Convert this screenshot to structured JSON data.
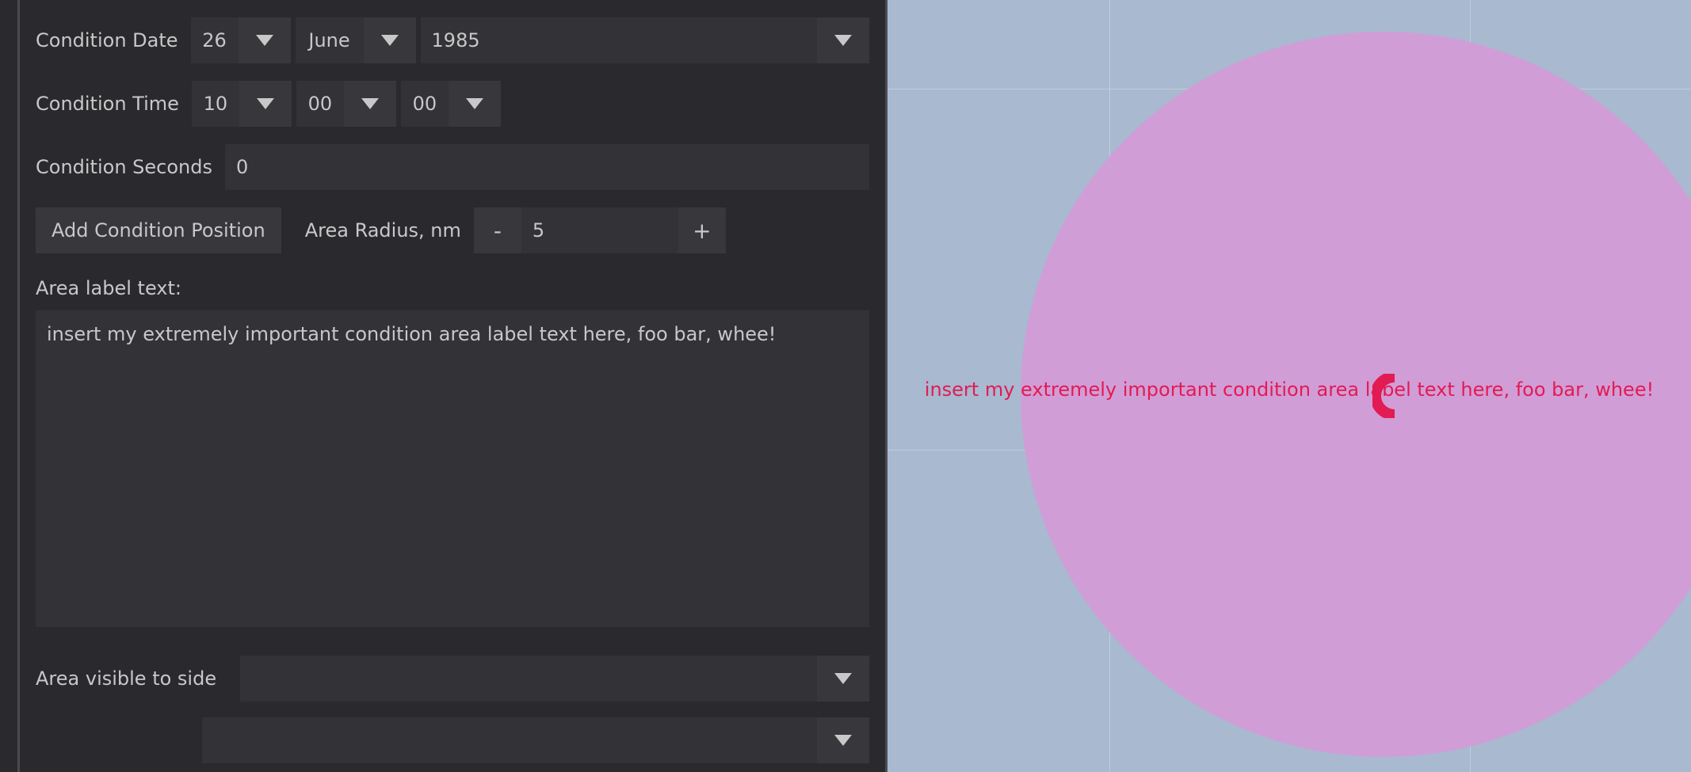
{
  "colors": {
    "panel_bg": "#2a2a2e",
    "field_bg": "#323237",
    "btn_bg": "#37373c",
    "text": "#c8c8c8",
    "map_bg": "#a8b9d0",
    "circle_fill": "#d19dd7",
    "accent": "#e21b52"
  },
  "panel": {
    "date": {
      "label": "Condition Date",
      "day": "26",
      "month": "June",
      "year": "1985"
    },
    "time": {
      "label": "Condition Time",
      "hour": "10",
      "minute": "00",
      "second": "00"
    },
    "seconds": {
      "label": "Condition Seconds",
      "value": "0"
    },
    "add_position_btn": "Add Condition Position",
    "radius": {
      "label": "Area Radius, nm",
      "value": "5",
      "minus": "-",
      "plus": "+"
    },
    "area_label_header": "Area label text:",
    "area_label_text": "insert my extremely important condition area label text here, foo bar, whee!",
    "visible_side": {
      "label": "Area visible to side",
      "value": ""
    }
  },
  "map": {
    "label_text": "insert my extremely important condition area label text here, foo bar, whee!"
  }
}
